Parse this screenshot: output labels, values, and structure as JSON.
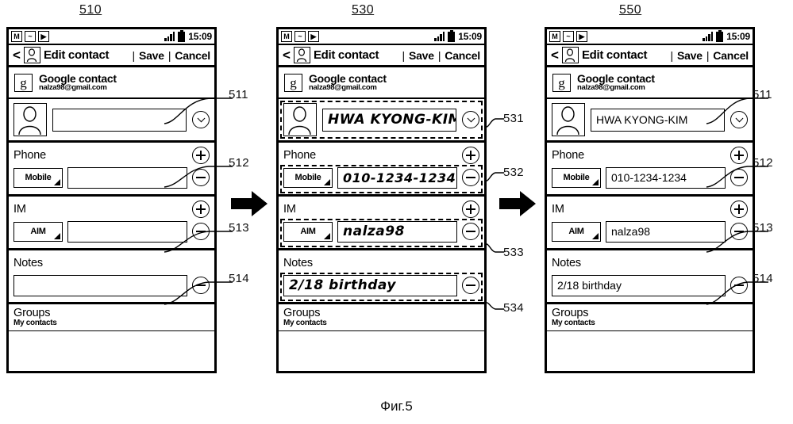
{
  "figure": {
    "caption": "Фиг.5",
    "panel_labels": [
      "510",
      "530",
      "550"
    ],
    "callout_numbers": {
      "panel1": [
        "511",
        "512",
        "513",
        "514"
      ],
      "panel2": [
        "531",
        "532",
        "533",
        "534"
      ],
      "panel3": [
        "511",
        "512",
        "513",
        "514"
      ]
    },
    "flow_arrow_icon": "right-arrow-icon"
  },
  "phone": {
    "statusbar": {
      "icons": [
        "mail-icon",
        "picture-icon",
        "media-play-icon"
      ],
      "mail_glyph": "M",
      "picture_glyph": "~",
      "play_glyph": "▶",
      "signal_icon": "signal-bars-icon",
      "battery_icon": "battery-icon",
      "time": "15:09"
    },
    "titlebar": {
      "back_icon": "<",
      "contact_icon": "person-icon",
      "title": "Edit contact",
      "separator": "|",
      "save_label": "Save",
      "cancel_label": "Cancel"
    },
    "account": {
      "badge": "g",
      "badge_icon": "google-g-icon",
      "title": "Google contact",
      "email": "nalza98@gmail.com"
    },
    "name_row": {
      "avatar_icon": "person-avatar-icon",
      "dropdown_icon": "chevron-down-circle-icon"
    },
    "sections": {
      "phone": {
        "label": "Phone",
        "add_icon": "plus-circle-icon",
        "remove_icon": "minus-circle-icon",
        "type": "Mobile",
        "type_dropdown_icon": "corner-triangle-icon"
      },
      "im": {
        "label": "IM",
        "add_icon": "plus-circle-icon",
        "remove_icon": "minus-circle-icon",
        "type": "AIM",
        "type_dropdown_icon": "corner-triangle-icon"
      },
      "notes": {
        "label": "Notes",
        "remove_icon": "minus-circle-icon"
      }
    },
    "groups": {
      "title": "Groups",
      "subtitle": "My contacts"
    }
  },
  "panels": {
    "p510": {
      "label": "510",
      "name_value": "",
      "phone_value": "",
      "im_value": "",
      "notes_value": ""
    },
    "p530": {
      "label": "530",
      "name_value": "HWA KYONG-KIM",
      "phone_value": "010-1234-1234",
      "im_value": "nalza98",
      "notes_value": "2/18  birthday"
    },
    "p550": {
      "label": "550",
      "name_value": "HWA KYONG-KIM",
      "phone_value": "010-1234-1234",
      "im_value": "nalza98",
      "notes_value": "2/18 birthday"
    }
  },
  "callouts": {
    "c511a": "511",
    "c512a": "512",
    "c513a": "513",
    "c514a": "514",
    "c531": "531",
    "c532": "532",
    "c533": "533",
    "c534": "534",
    "c511b": "511",
    "c512b": "512",
    "c513b": "513",
    "c514b": "514"
  }
}
